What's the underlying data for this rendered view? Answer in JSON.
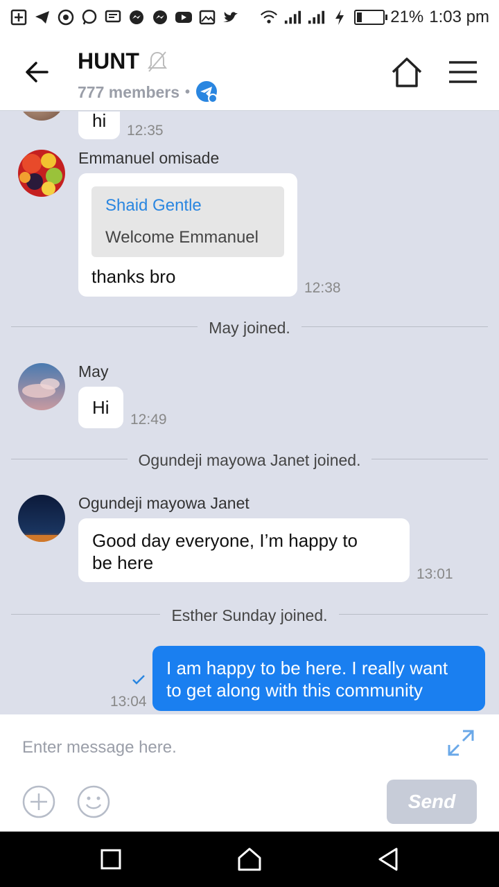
{
  "status_bar": {
    "battery": "21%",
    "battery_level": 0.21,
    "time": "1:03 pm",
    "icons": [
      "plus-box-icon",
      "telegram-icon",
      "app-icon",
      "whatsapp-icon",
      "message-icon",
      "messenger-icon",
      "messenger-icon",
      "youtube-icon",
      "gallery-icon",
      "twitter-icon",
      "wifi-icon",
      "signal-icon",
      "signal-icon",
      "charging-icon",
      "battery-icon"
    ]
  },
  "header": {
    "title": "HUNT",
    "members": "777 members",
    "accent_color": "#2a86e0"
  },
  "messages": {
    "m1": {
      "text": "hi",
      "time": "12:35"
    },
    "m2": {
      "sender": "Emmanuel omisade",
      "quote_name": "Shaid Gentle",
      "quote_text": "Welcome Emmanuel",
      "text": "thanks bro",
      "time": "12:38"
    },
    "sys1": "May  joined.",
    "m3": {
      "sender": "May",
      "text": "Hi",
      "time": "12:49"
    },
    "sys2": "Ogundeji mayowa Janet joined.",
    "m4": {
      "sender": "Ogundeji mayowa Janet",
      "text_line1": "Good day everyone, I’m happy to",
      "text_line2": "be here",
      "time": "13:01"
    },
    "sys3": "Esther Sunday joined.",
    "m5": {
      "text_line1": "I am happy to be here.  I really want",
      "text_line2": "to get along with this community",
      "time": "13:04",
      "bubble_color": "#1a7ff0"
    }
  },
  "input": {
    "placeholder": "Enter message here.",
    "send_label": "Send"
  }
}
